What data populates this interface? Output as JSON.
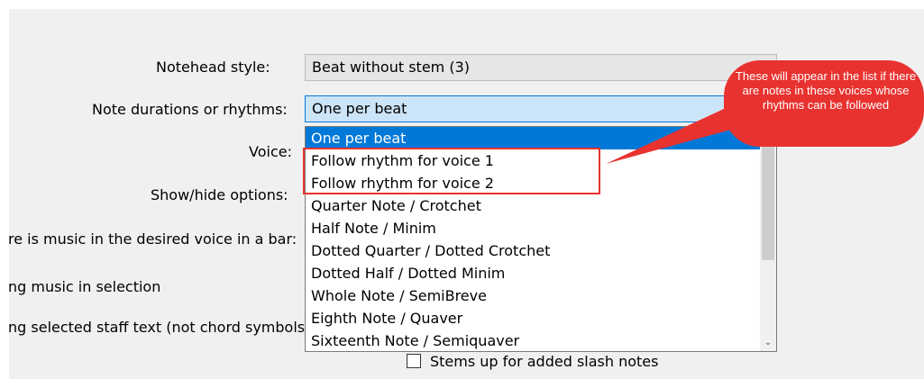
{
  "form": {
    "notehead_label": "Notehead style:",
    "notehead_value": "Beat without stem (3)",
    "durations_label": "Note durations or rhythms:",
    "durations_value": "One per beat",
    "voice_label": "Voice:",
    "showhide_label": "Show/hide options:",
    "music_bar_label": "re is music in the desired voice in a bar:",
    "selection_label": "ng music in selection",
    "staff_text_label": "ng selected staff text (not chord symbols",
    "stems_label": "Stems up for added slash notes"
  },
  "dropdown": {
    "options": [
      "One per beat",
      "Follow rhythm for voice 1",
      "Follow rhythm for voice 2",
      "Quarter Note / Crotchet",
      "Half Note / Minim",
      "Dotted Quarter / Dotted Crotchet",
      "Dotted Half / Dotted Minim",
      "Whole Note / SemiBreve",
      "Eighth Note / Quaver",
      "Sixteenth Note / Semiquaver"
    ],
    "selected_index": 0,
    "scroll_down_icon": "chevron-down-icon"
  },
  "callout": {
    "text": "These will appear in the list if there are notes in these voices whose rhythms can be followed",
    "color": "#e8322f"
  },
  "colors": {
    "selection": "#0078d7",
    "active_combo": "#cce4f7"
  }
}
